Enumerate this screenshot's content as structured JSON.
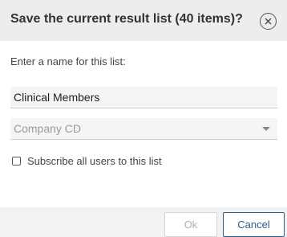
{
  "dialog": {
    "title": "Save the current result list (40 items)?",
    "close_icon": "close-circle-icon",
    "prompt": "Enter a name for this list:",
    "name_value": "Clinical Members",
    "company_select": {
      "selected": "Company CD",
      "arrow_icon": "chevron-down-icon"
    },
    "subscribe": {
      "label": "Subscribe all users to this list",
      "checked": false
    },
    "buttons": {
      "ok_label": "Ok",
      "ok_enabled": false,
      "cancel_label": "Cancel"
    },
    "colors": {
      "header_bg": "#ededed",
      "accent": "#2a5d88",
      "disabled_text": "#b0b0b0"
    }
  }
}
